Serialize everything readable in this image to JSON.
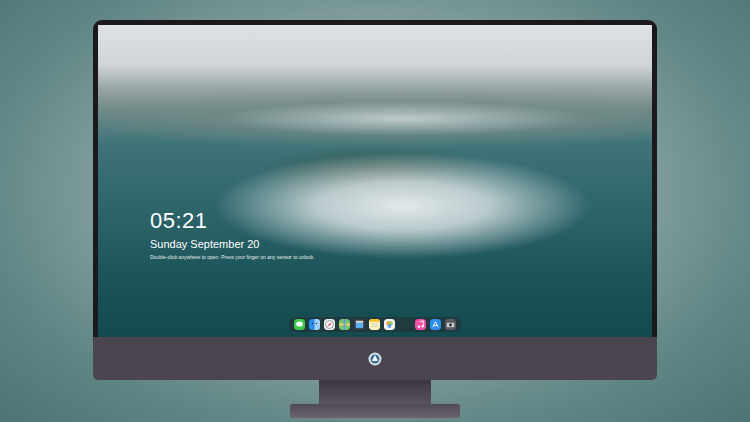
{
  "screen": {
    "clock": "05:21",
    "date": "Sunday September 20",
    "hint": "Double-click anywhere to open. Press your finger on any sensor to unlock."
  }
}
